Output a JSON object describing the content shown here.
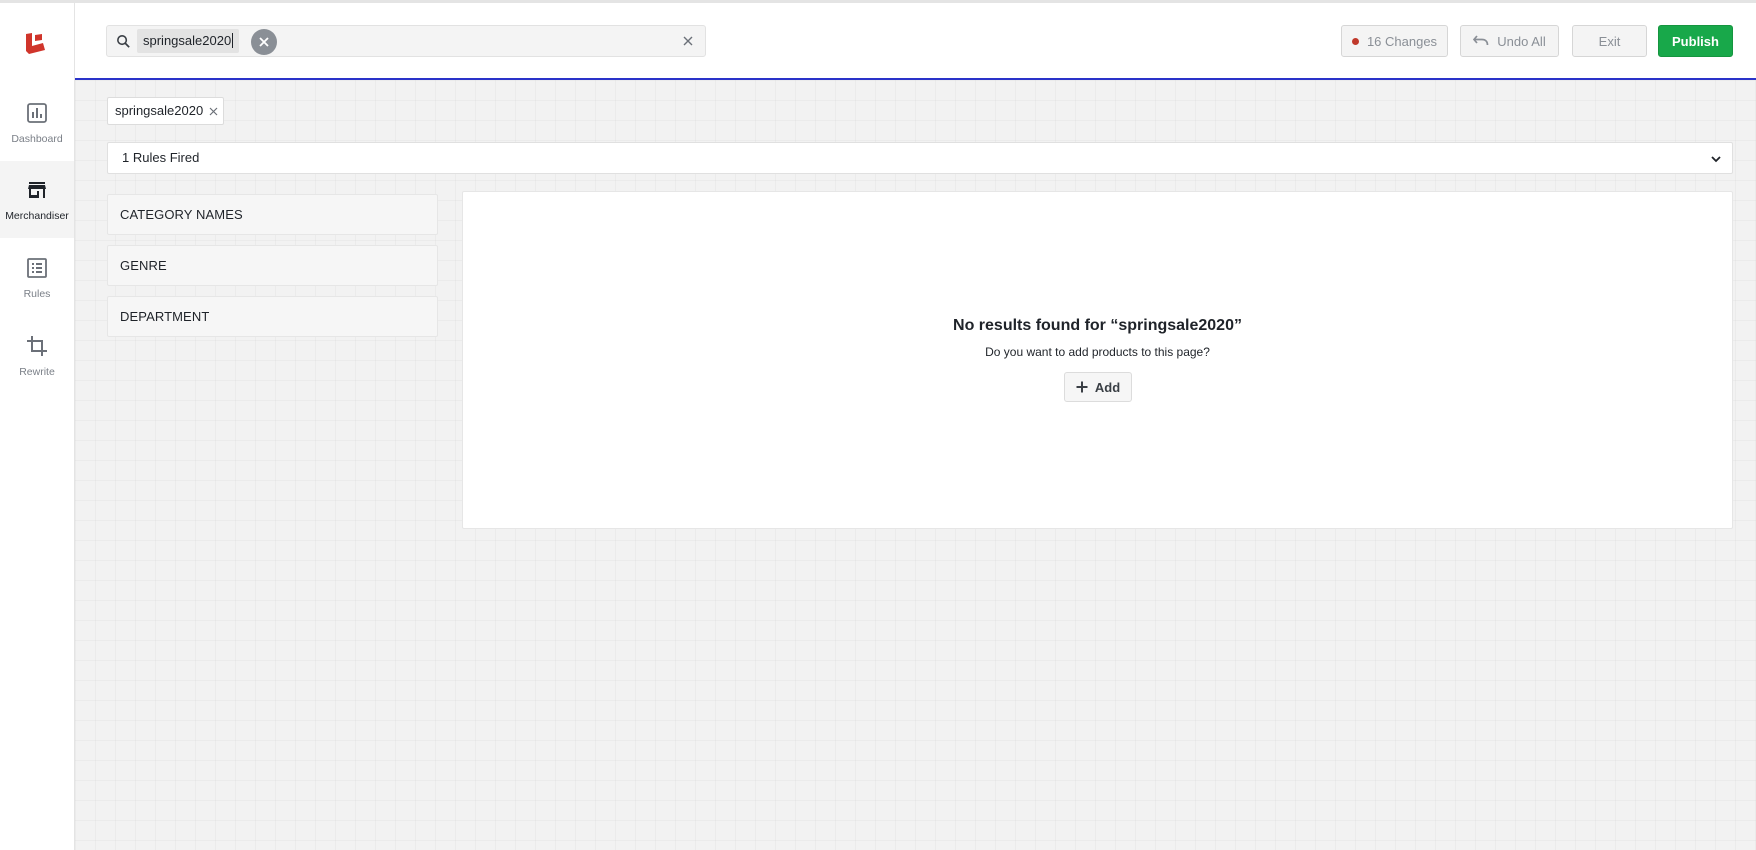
{
  "sidebar": {
    "items": [
      {
        "label": "Dashboard",
        "icon": "bar-chart-icon"
      },
      {
        "label": "Merchandiser",
        "icon": "storefront-icon"
      },
      {
        "label": "Rules",
        "icon": "list-icon"
      },
      {
        "label": "Rewrite",
        "icon": "crop-icon"
      }
    ],
    "active": "Merchandiser"
  },
  "header": {
    "search_chip": "springsale2020",
    "changes_label": "16 Changes",
    "undo_label": "Undo All",
    "exit_label": "Exit",
    "publish_label": "Publish"
  },
  "main": {
    "active_tag": "springsale2020",
    "rules_fired": "1 Rules Fired",
    "facets": [
      "CATEGORY NAMES",
      "GENRE",
      "DEPARTMENT"
    ],
    "empty_title": "No results found for “springsale2020”",
    "empty_subtitle": "Do you want to add products to this page?",
    "add_label": "Add"
  },
  "colors": {
    "accent_line": "#2a33c9",
    "publish": "#18a84a",
    "brand": "#d0352b",
    "changes_dot": "#c0392b"
  }
}
